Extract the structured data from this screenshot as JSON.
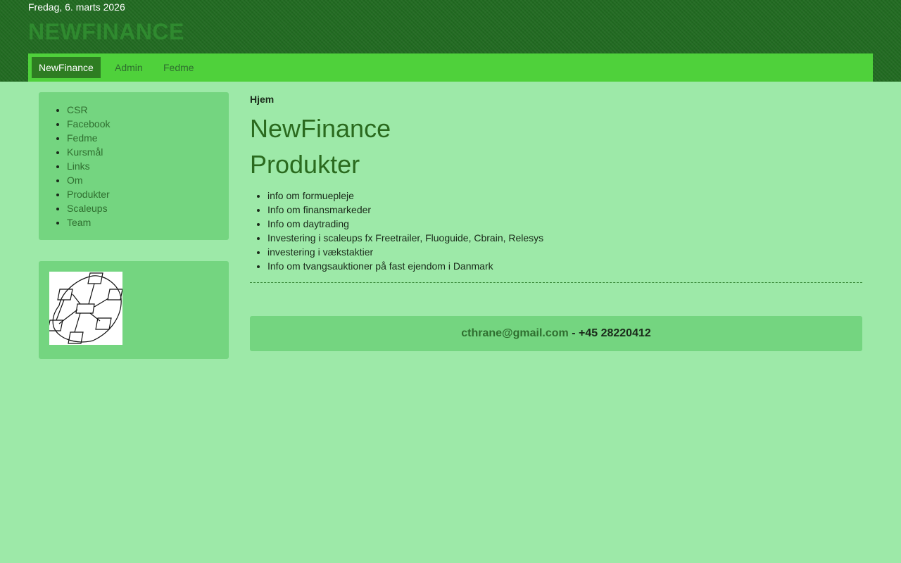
{
  "header": {
    "date": "Fredag, 6. marts 2026",
    "site_title": "NEWFINANCE"
  },
  "nav": {
    "items": [
      {
        "label": "NewFinance",
        "active": true
      },
      {
        "label": "Admin"
      },
      {
        "label": "Fedme"
      }
    ]
  },
  "sidebar": {
    "links": [
      "CSR",
      "Facebook",
      "Fedme",
      "Kursmål",
      "Links",
      "Om",
      "Produkter",
      "Scaleups",
      "Team"
    ],
    "logo_icon": "network-diagram-icon"
  },
  "main": {
    "breadcrumb": "Hjem",
    "title": "NewFinance",
    "subtitle": "Produkter",
    "items": [
      "info om formuepleje",
      "Info om finansmarkeder",
      "Info om daytrading",
      "Investering i scaleups fx Freetrailer, Fluoguide, Cbrain, Relesys",
      "investering i vækstaktier",
      "Info om tvangsauktioner på fast ejendom i Danmark"
    ]
  },
  "footer": {
    "email": "cthrane@gmail.com",
    "phone_text": " - +45 28220412"
  },
  "colors": {
    "background": "#9de9a8",
    "header": "#216b21",
    "navbar": "#4fd13b",
    "nav_active": "#2e7d22",
    "panel": "#74d580",
    "heading": "#2a6a1e",
    "link": "#2f6e2f"
  }
}
